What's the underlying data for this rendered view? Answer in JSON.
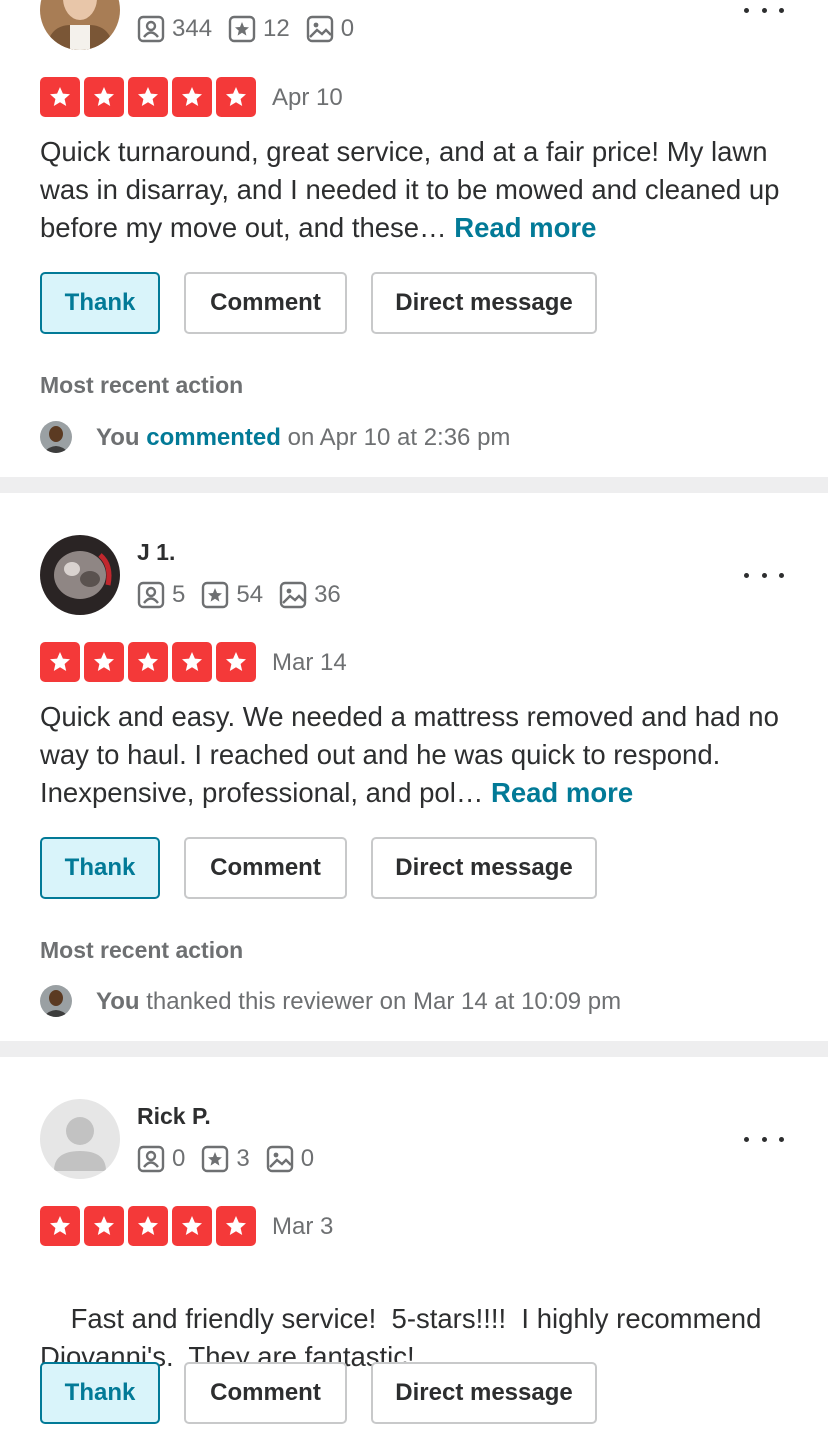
{
  "reviews": [
    {
      "name": "",
      "stats": {
        "friends": "344",
        "reviews": "12",
        "photos": "0"
      },
      "rating": 5,
      "date": "Apr 10",
      "text": "Quick turnaround, great service, and at a fair price! My lawn was in disarray, and I needed it to be mowed and cleaned up before my move out, and these…",
      "read_more": "Read more",
      "actions": {
        "thank": "Thank",
        "comment": "Comment",
        "dm": "Direct message"
      },
      "recent": {
        "title": "Most recent action",
        "you": "You",
        "verb": "commented",
        "rest": " on Apr 10 at 2:36 pm"
      }
    },
    {
      "name": "J 1.",
      "stats": {
        "friends": "5",
        "reviews": "54",
        "photos": "36"
      },
      "rating": 5,
      "date": "Mar 14",
      "text": "Quick and easy. We needed a mattress removed and had no way to haul. I reached out and he was quick to respond. Inexpensive, professional, and pol…",
      "read_more": "Read more",
      "actions": {
        "thank": "Thank",
        "comment": "Comment",
        "dm": "Direct message"
      },
      "recent": {
        "title": "Most recent action",
        "you": "You",
        "rest": " thanked this reviewer on Mar 14 at 10:09 pm"
      }
    },
    {
      "name": "Rick P.",
      "stats": {
        "friends": "0",
        "reviews": "3",
        "photos": "0"
      },
      "rating": 5,
      "date": "Mar 3",
      "text": "Fast and friendly service!  5-stars!!!!  I highly recommend Diovanni's.  They are fantastic!",
      "actions": {
        "thank": "Thank",
        "comment": "Comment",
        "dm": "Direct message"
      }
    }
  ],
  "colors": {
    "star": "#f43939",
    "accent": "#027a97",
    "thank_bg": "#d9f4fa"
  }
}
